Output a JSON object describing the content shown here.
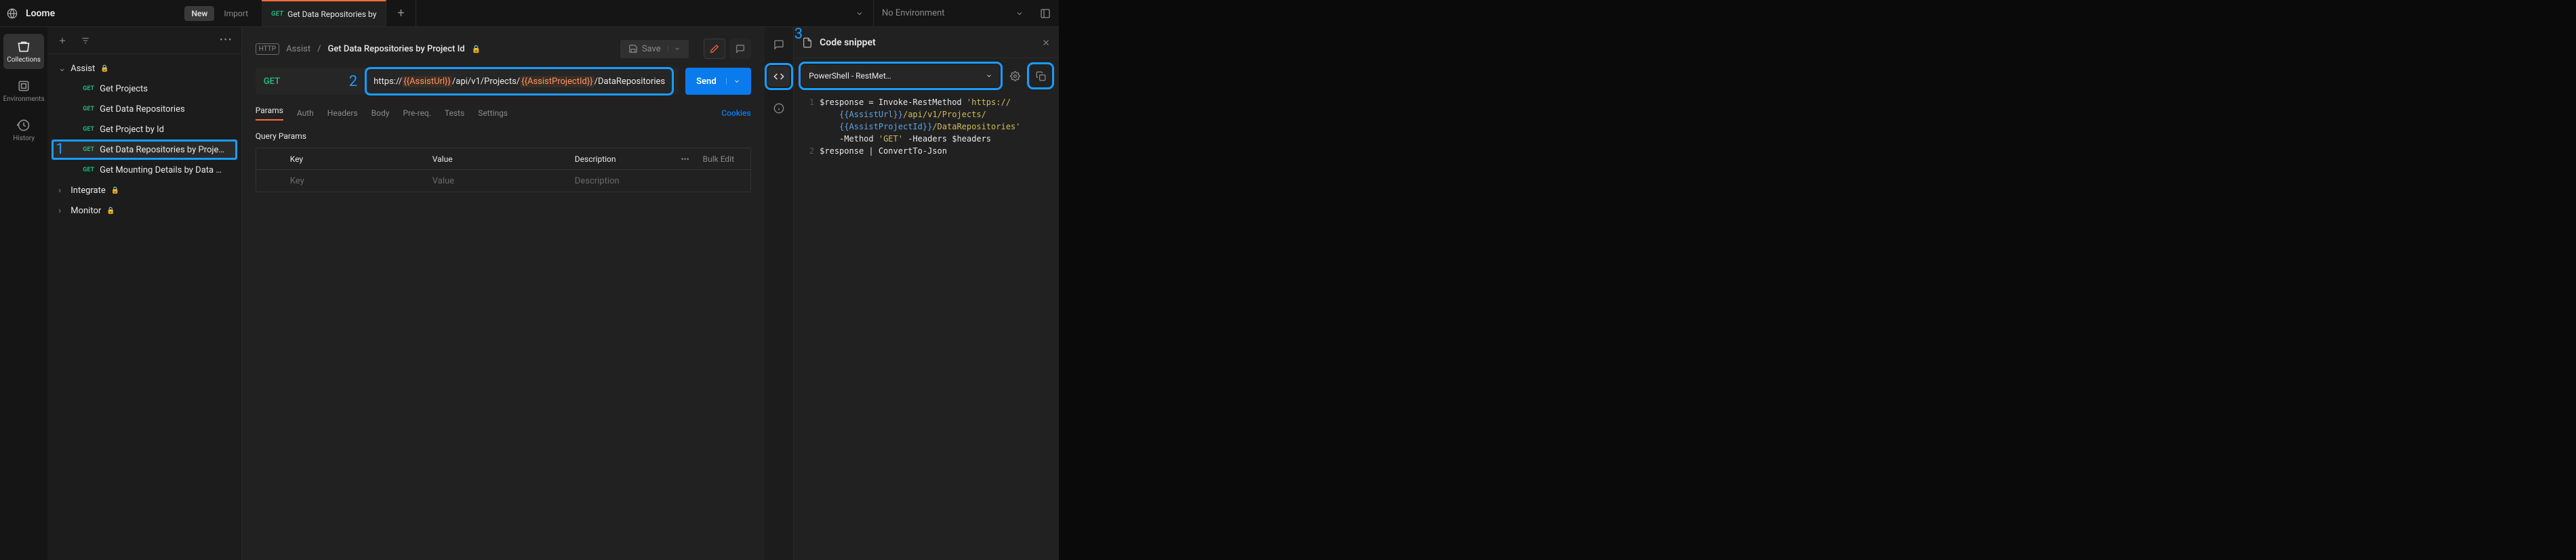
{
  "workspace": "Loome",
  "topbar": {
    "new": "New",
    "import": "Import"
  },
  "tab": {
    "method": "GET",
    "title": "Get Data Repositories by"
  },
  "env": {
    "label": "No Environment"
  },
  "rail": {
    "collections": "Collections",
    "environments": "Environments",
    "history": "History"
  },
  "tree": {
    "assist": "Assist",
    "items": [
      "Get Projects",
      "Get Data Repositories",
      "Get Project by Id",
      "Get Data Repositories by Proje…",
      "Get Mounting Details by Data …"
    ],
    "integrate": "Integrate",
    "monitor": "Monitor",
    "method": "GET"
  },
  "annotations": {
    "one": "1",
    "two": "2",
    "three": "3"
  },
  "breadcrumb": {
    "http": "HTTP",
    "parent": "Assist",
    "sep": "/",
    "name": "Get Data Repositories by Project Id"
  },
  "actions": {
    "save": "Save"
  },
  "request": {
    "method": "GET",
    "url_pre": "https://",
    "var1": "{{AssistUrl}}",
    "url_mid": "/api/v1/Projects/",
    "var2": "{{AssistProjectId}}",
    "url_post": "/DataRepositories",
    "send": "Send"
  },
  "reqtabs": {
    "params": "Params",
    "auth": "Auth",
    "headers": "Headers",
    "body": "Body",
    "prereq": "Pre-req.",
    "tests": "Tests",
    "settings": "Settings",
    "cookies": "Cookies"
  },
  "query": {
    "title": "Query Params",
    "key": "Key",
    "value": "Value",
    "description": "Description",
    "bulk": "Bulk Edit",
    "ph_key": "Key",
    "ph_value": "Value",
    "ph_desc": "Description"
  },
  "codepanel": {
    "title": "Code snippet",
    "language": "PowerShell - RestMet…"
  },
  "code": {
    "l1a": "$response = Invoke-RestMethod ",
    "l1s1": "'https://",
    "l2v": "{{AssistUrl}}",
    "l2s": "/api/v1/Projects/",
    "l3v": "{{AssistProjectId}}",
    "l3s": "/DataRepositories'",
    "l4a": "    -Method ",
    "l4s": "'GET'",
    "l4b": " -Headers $headers",
    "l5": "$response | ConvertTo-Json"
  }
}
